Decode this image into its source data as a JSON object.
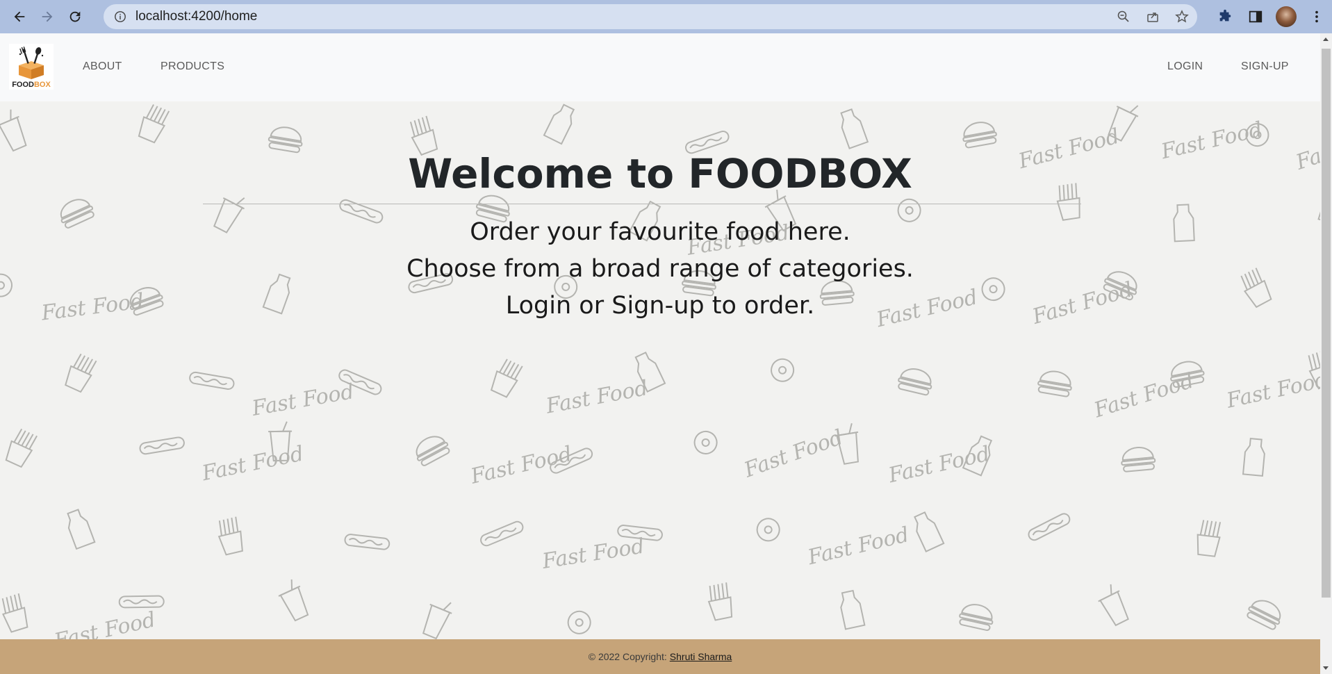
{
  "browser": {
    "url": "localhost:4200/home",
    "icons": {
      "back": "arrow-left-icon",
      "forward": "arrow-right-icon",
      "reload": "reload-icon",
      "info": "info-icon",
      "zoom": "zoom-out-icon",
      "share": "share-icon",
      "bookmark": "star-icon",
      "extensions": "puzzle-icon",
      "sidepanel": "side-panel-icon",
      "menu": "kebab-menu-icon"
    }
  },
  "navbar": {
    "logo": {
      "text_food": "FOOD",
      "text_box": "BOX"
    },
    "links": {
      "about": "ABOUT",
      "products": "PRODUCTS",
      "login": "LOGIN",
      "signup": "SIGN-UP"
    }
  },
  "hero": {
    "title": "Welcome to FOODBOX",
    "lines": [
      "Order your favourite food here.",
      "Choose from a broad range of categories.",
      "Login or Sign-up to order."
    ],
    "pattern_text": "Fast Food"
  },
  "footer": {
    "copyright": "© 2022 Copyright:",
    "author": "Shruti Sharma"
  },
  "colors": {
    "chrome": "#aec0e0",
    "omnibox": "#d6e0f1",
    "navbar": "#f8f9fa",
    "hero_bg": "#f2f2f0",
    "footer": "#c6a479",
    "logo_accent": "#e8963a"
  }
}
